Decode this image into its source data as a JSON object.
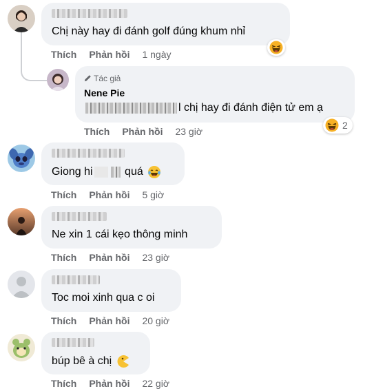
{
  "comments": [
    {
      "text_prefix": "Chị này hay đi đánh golf đúng khum nhỉ",
      "actions": {
        "like": "Thích",
        "reply": "Phản hồi",
        "time": "1 ngày"
      },
      "reaction": {
        "icon": "laughing-emoji-icon"
      }
    },
    {
      "author_badge": "Tác giả",
      "name": "Nene Pie",
      "text_suffix": "l chị hay đi đánh điện tử em ạ",
      "actions": {
        "like": "Thích",
        "reply": "Phản hồi",
        "time": "23 giờ"
      },
      "reaction": {
        "icon": "laughing-emoji-icon",
        "count": "2"
      }
    },
    {
      "text_part1": "Giong hi",
      "text_part2": "quá",
      "actions": {
        "like": "Thích",
        "reply": "Phản hồi",
        "time": "5 giờ"
      }
    },
    {
      "text": "Ne xin 1 cái kẹo thông minh",
      "actions": {
        "like": "Thích",
        "reply": "Phản hồi",
        "time": "23 giờ"
      }
    },
    {
      "text": "Toc moi xinh qua c oi",
      "actions": {
        "like": "Thích",
        "reply": "Phản hồi",
        "time": "20 giờ"
      }
    },
    {
      "text": "búp bê à chị",
      "actions": {
        "like": "Thích",
        "reply": "Phản hồi",
        "time": "22 giờ"
      }
    }
  ]
}
